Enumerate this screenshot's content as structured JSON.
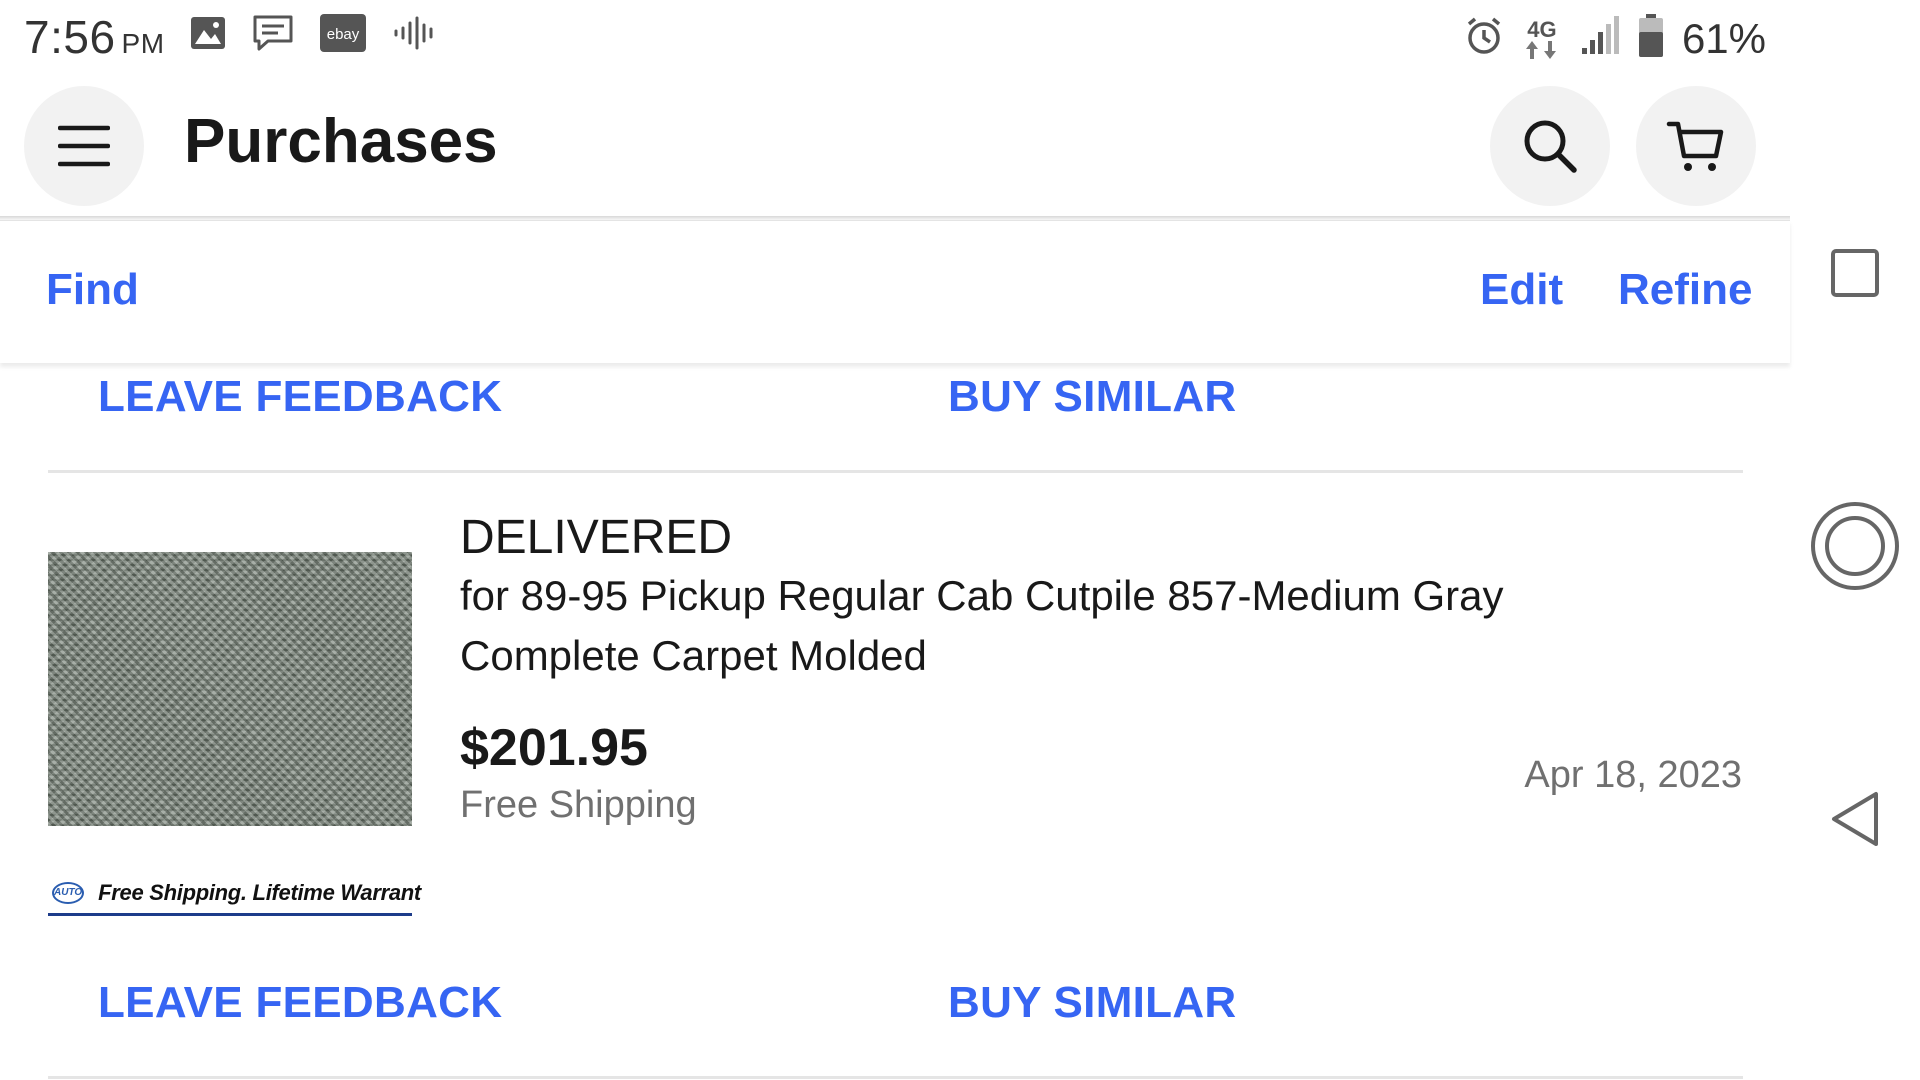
{
  "status_bar": {
    "time": "7:56",
    "ampm": "PM",
    "network": "4G",
    "battery": "61%"
  },
  "header": {
    "title": "Purchases"
  },
  "toolbar": {
    "find": "Find",
    "edit": "Edit",
    "refine": "Refine"
  },
  "orders": [
    {
      "leave_feedback": "LEAVE FEEDBACK",
      "buy_similar": "BUY SIMILAR"
    },
    {
      "status": "DELIVERED",
      "title": "for 89-95 Pickup Regular Cab Cutpile 857-Medium Gray Complete Carpet Molded",
      "price": "$201.95",
      "shipping": "Free Shipping",
      "date": "Apr 18, 2023",
      "promo_logo": "AUTO",
      "promo_text": "Free Shipping. Lifetime Warrant",
      "leave_feedback": "LEAVE FEEDBACK",
      "buy_similar": "BUY SIMILAR"
    }
  ],
  "colors": {
    "link": "#3665f3",
    "text": "#191919",
    "muted": "#707070"
  }
}
